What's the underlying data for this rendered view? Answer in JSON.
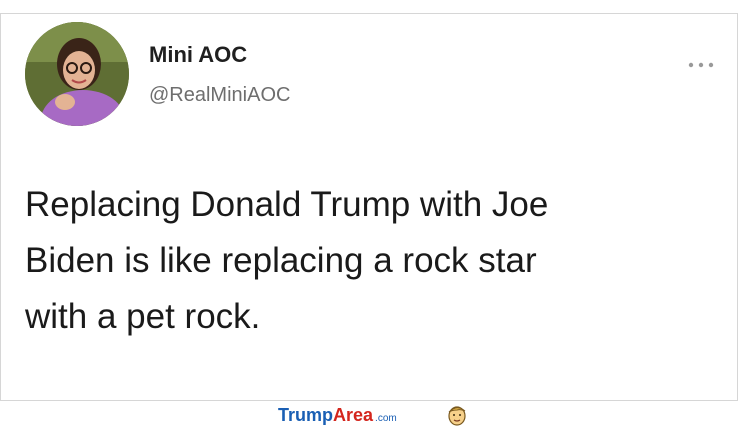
{
  "tweet": {
    "display_name": "Mini AOC",
    "handle": "@RealMiniAOC",
    "text_lines": [
      "Replacing Donald Trump with Joe",
      "Biden is like replacing a rock star",
      "with a pet rock."
    ],
    "more_icon": "more-horizontal-icon",
    "avatar_icon": "profile-photo"
  },
  "watermark": {
    "brand_part1": "Trump",
    "brand_part2": "Area",
    "domain_suffix": ".com",
    "logo_icon": "trump-face-logo",
    "colors": {
      "trump": "#1a5fb4",
      "area": "#d4261d"
    }
  }
}
